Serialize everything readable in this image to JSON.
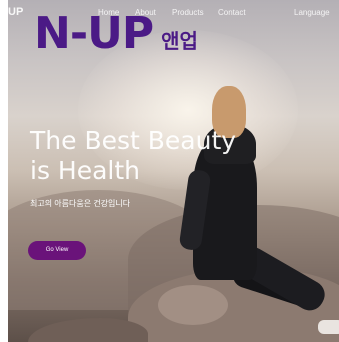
{
  "nav": {
    "logo": "UP",
    "links": [
      "Home",
      "About",
      "Products",
      "Contact",
      "Language"
    ]
  },
  "brand": {
    "name": "N-UP",
    "korean": "앤업",
    "color": "#4b1a86"
  },
  "hero": {
    "headline_line1": "The Best Beauty",
    "headline_line2": "is Health",
    "subline": "최고의 아름다움은 건강입니다",
    "cta_label": "Go View",
    "cta_color": "#6a137a"
  }
}
